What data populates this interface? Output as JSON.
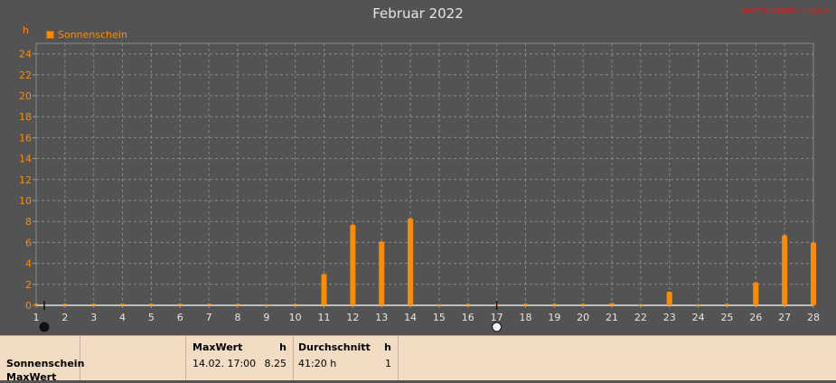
{
  "chart": {
    "title": "Februar 2022",
    "brand": "Wetterstation Halle",
    "unit": "h",
    "legend": "Sonnenschein",
    "color": "#ff8c00"
  },
  "chart_data": {
    "type": "bar",
    "title": "Februar 2022",
    "ylabel": "h",
    "ylim": [
      0,
      25
    ],
    "yticks": [
      0,
      2,
      4,
      6,
      8,
      10,
      12,
      14,
      16,
      18,
      20,
      22,
      24
    ],
    "grid": true,
    "legend_position": "top-left",
    "categories": [
      "1",
      "2",
      "3",
      "4",
      "5",
      "6",
      "7",
      "8",
      "9",
      "10",
      "11",
      "12",
      "13",
      "14",
      "15",
      "16",
      "17",
      "18",
      "19",
      "20",
      "21",
      "22",
      "23",
      "24",
      "25",
      "26",
      "27",
      "28"
    ],
    "series": [
      {
        "name": "Sonnenschein",
        "values": [
          0,
          0,
          0,
          0,
          0,
          0,
          0,
          0,
          0.1,
          0,
          3.0,
          7.7,
          6.1,
          8.3,
          0.1,
          0,
          0,
          0,
          0,
          0,
          0.2,
          0.1,
          1.3,
          0.1,
          0,
          2.2,
          6.7,
          6.0
        ]
      }
    ]
  },
  "table": {
    "row_labels": [
      "Sonnenschein",
      "MaxWert"
    ],
    "max_header": "MaxWert",
    "max_unit": "h",
    "max_time": "14.02.  17:00",
    "max_value": "8.25",
    "avg_header": "Durchschnitt",
    "avg_unit": "h",
    "avg_value": "41:20 h",
    "avg_count": "1"
  }
}
